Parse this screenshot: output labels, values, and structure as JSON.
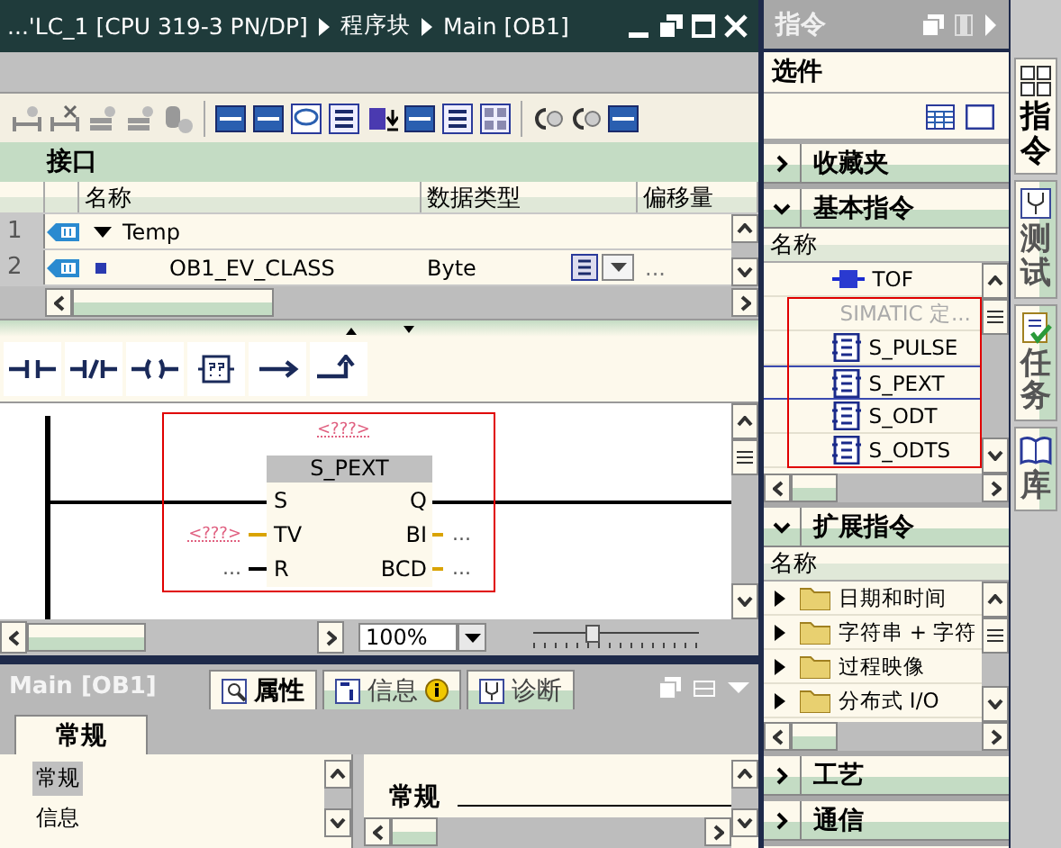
{
  "editor": {
    "breadcrumb": [
      "...'LC_1 [CPU 319-3 PN/DP]",
      "程序块",
      "Main [OB1]"
    ]
  },
  "interface": {
    "title": "接口",
    "columns": [
      "名称",
      "数据类型",
      "偏移量"
    ],
    "rows": [
      {
        "number": "1",
        "kind": "section",
        "name": "Temp",
        "expanded": true
      },
      {
        "number": "2",
        "kind": "variable",
        "name": "OB1_EV_CLASS",
        "type": "Byte",
        "offset": "..."
      }
    ]
  },
  "ladder": {
    "network": {
      "title": "<???>",
      "block": {
        "name": "S_PEXT",
        "inputs": [
          {
            "pin": "S",
            "kind": "rung"
          },
          {
            "pin": "TV",
            "kind": "word",
            "operand": "<???>"
          },
          {
            "pin": "R",
            "kind": "bool",
            "operand": "..."
          }
        ],
        "outputs": [
          {
            "pin": "Q",
            "kind": "rung"
          },
          {
            "pin": "BI",
            "kind": "word",
            "operand": "..."
          },
          {
            "pin": "BCD",
            "kind": "word",
            "operand": "..."
          }
        ]
      }
    },
    "zoom": "100%",
    "zoom_slider": {
      "level": 0.37
    }
  },
  "inspector": {
    "object": "Main [OB1]",
    "tabs": [
      {
        "label": "属性",
        "selected": true
      },
      {
        "label": "信息",
        "selected": false,
        "notice": true
      },
      {
        "label": "诊断",
        "selected": false
      }
    ],
    "subtabs": [
      {
        "label": "常规",
        "selected": true
      }
    ],
    "nav": [
      {
        "label": "常规",
        "selected": true
      },
      {
        "label": "信息",
        "selected": false
      }
    ],
    "heading": "常规"
  },
  "instructions": {
    "title": "指令",
    "options": "选件",
    "sections": [
      {
        "label": "收藏夹",
        "expanded": false
      },
      {
        "label": "基本指令",
        "expanded": true,
        "column": "名称",
        "items": [
          {
            "kind": "coil",
            "label": "TOF",
            "selected": false,
            "disabled": false
          },
          {
            "kind": "group",
            "label": "SIMATIC 定...",
            "selected": false,
            "disabled": true
          },
          {
            "kind": "box",
            "label": "S_PULSE",
            "selected": false,
            "disabled": false
          },
          {
            "kind": "box",
            "label": "S_PEXT",
            "selected": true,
            "disabled": false
          },
          {
            "kind": "box",
            "label": "S_ODT",
            "selected": false,
            "disabled": false
          },
          {
            "kind": "box",
            "label": "S_ODTS",
            "selected": false,
            "disabled": false
          }
        ]
      },
      {
        "label": "扩展指令",
        "expanded": true,
        "column": "名称",
        "items": [
          {
            "kind": "folder",
            "label": "日期和时间"
          },
          {
            "kind": "folder",
            "label": "字符串 + 字符"
          },
          {
            "kind": "folder",
            "label": "过程映像"
          },
          {
            "kind": "folder",
            "label": "分布式 I/O"
          }
        ]
      },
      {
        "label": "工艺",
        "expanded": false
      },
      {
        "label": "通信",
        "expanded": false
      }
    ]
  },
  "side_tabs": [
    {
      "label": "指令",
      "selected": true
    },
    {
      "label": "测试",
      "selected": false
    },
    {
      "label": "任务",
      "selected": false
    },
    {
      "label": "库",
      "selected": false
    }
  ]
}
